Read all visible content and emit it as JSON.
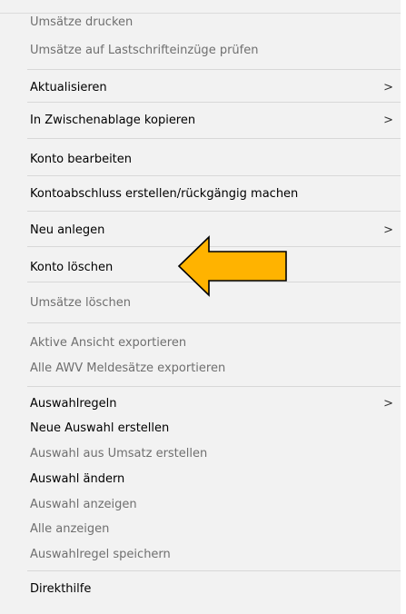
{
  "menu": {
    "items": [
      {
        "label": "Umsätze drucken",
        "enabled": false,
        "submenu": false
      },
      {
        "label": "Umsätze auf Lastschrifteinzüge prüfen",
        "enabled": false,
        "submenu": false
      },
      {
        "label": "Aktualisieren",
        "enabled": true,
        "submenu": true
      },
      {
        "label": "In Zwischenablage kopieren",
        "enabled": true,
        "submenu": true
      },
      {
        "label": "Konto bearbeiten",
        "enabled": true,
        "submenu": false
      },
      {
        "label": "Kontoabschluss erstellen/rückgängig machen",
        "enabled": true,
        "submenu": false
      },
      {
        "label": "Neu anlegen",
        "enabled": true,
        "submenu": true
      },
      {
        "label": "Konto löschen",
        "enabled": true,
        "submenu": false
      },
      {
        "label": "Umsätze löschen",
        "enabled": false,
        "submenu": false
      },
      {
        "label": "Aktive Ansicht exportieren",
        "enabled": false,
        "submenu": false
      },
      {
        "label": "Alle AWV Meldesätze exportieren",
        "enabled": false,
        "submenu": false
      },
      {
        "label": "Auswahlregeln",
        "enabled": true,
        "submenu": true
      },
      {
        "label": "Neue Auswahl erstellen",
        "enabled": true,
        "submenu": false
      },
      {
        "label": "Auswahl aus Umsatz erstellen",
        "enabled": false,
        "submenu": false
      },
      {
        "label": "Auswahl ändern",
        "enabled": true,
        "submenu": false
      },
      {
        "label": "Auswahl anzeigen",
        "enabled": false,
        "submenu": false
      },
      {
        "label": "Alle anzeigen",
        "enabled": false,
        "submenu": false
      },
      {
        "label": "Auswahlregel speichern",
        "enabled": false,
        "submenu": false
      },
      {
        "label": "Direkthilfe",
        "enabled": true,
        "submenu": false
      }
    ],
    "submenu_glyph": ">"
  },
  "annotation": {
    "icon": "arrow-left-icon",
    "color": "#FFB300"
  }
}
